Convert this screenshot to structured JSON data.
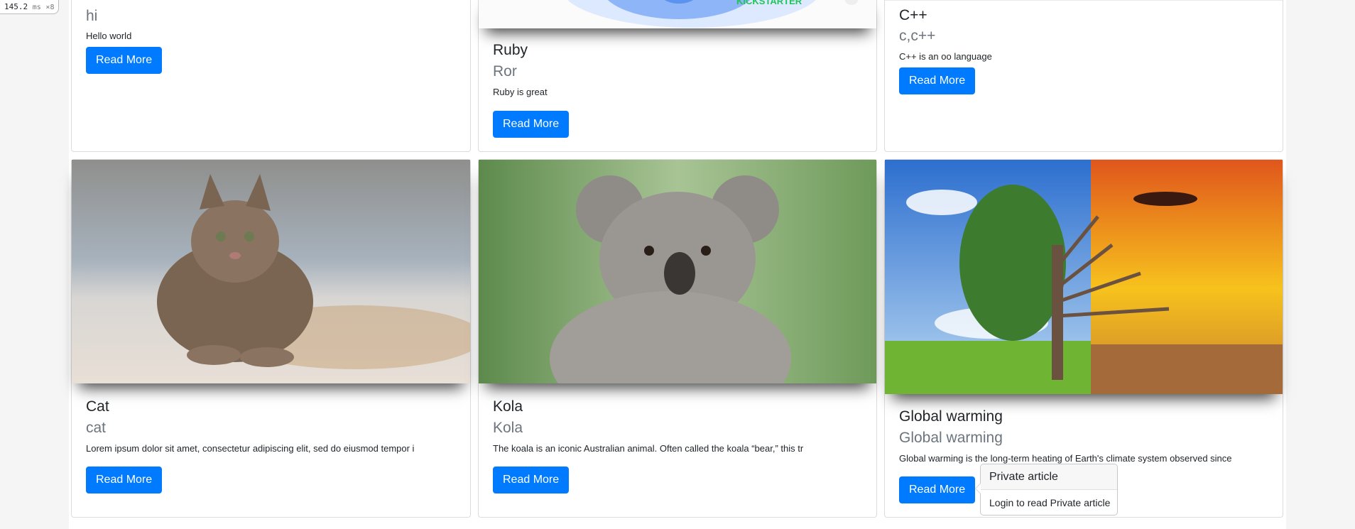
{
  "perf": {
    "value": "145.2",
    "unit": "ms",
    "mult": "×8"
  },
  "cards": [
    {
      "title": "",
      "subtitle": "hi",
      "text": "Hello world",
      "button": "Read More"
    },
    {
      "title": "Ruby",
      "subtitle": "Ror",
      "text": "Ruby is great",
      "button": "Read More",
      "logo_text": "KICKSTARTER"
    },
    {
      "title": "C++",
      "subtitle": "c,c++",
      "text": "C++ is an oo language",
      "button": "Read More"
    },
    {
      "title": "Cat",
      "subtitle": "cat",
      "text": "Lorem ipsum dolor sit amet, consectetur adipiscing elit, sed do eiusmod tempor i",
      "button": "Read More"
    },
    {
      "title": "Kola",
      "subtitle": "Kola",
      "text": "The koala is an iconic Australian animal. Often called the koala “bear,” this tr",
      "button": "Read More"
    },
    {
      "title": "Global warming",
      "subtitle": "Global warming",
      "text": "Global warming is the long-term heating of Earth's climate system observed since",
      "button": "Read More"
    }
  ],
  "popover": {
    "header": "Private article",
    "body": "Login to read Private article"
  }
}
